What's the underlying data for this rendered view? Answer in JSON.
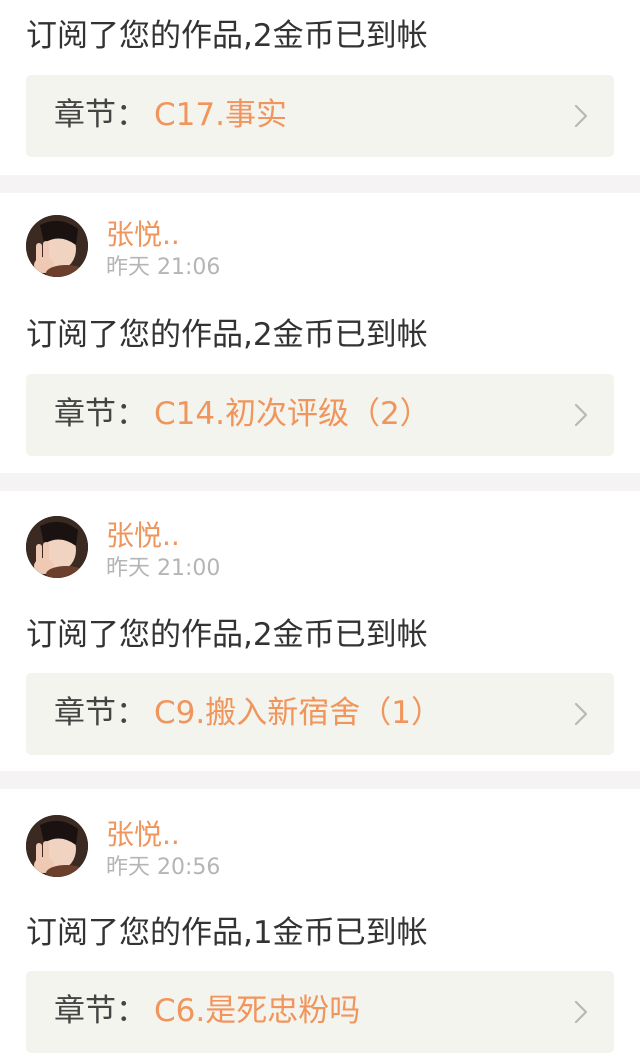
{
  "items": [
    {
      "message": "订阅了您的作品,2金币已到帐",
      "chapter_label": "章节：",
      "chapter_title": "C17.事实"
    },
    {
      "username": "张悦..",
      "time": "昨天 21:06",
      "message": "订阅了您的作品,2金币已到帐",
      "chapter_label": "章节：",
      "chapter_title": "C14.初次评级（2）"
    },
    {
      "username": "张悦..",
      "time": "昨天 21:00",
      "message": "订阅了您的作品,2金币已到帐",
      "chapter_label": "章节：",
      "chapter_title": "C9.搬入新宿舍（1）"
    },
    {
      "username": "张悦..",
      "time": "昨天 20:56",
      "message": "订阅了您的作品,1金币已到帐",
      "chapter_label": "章节：",
      "chapter_title": "C6.是死忠粉吗"
    }
  ],
  "colors": {
    "accent": "#f0955c",
    "separator": "#f5f3f3",
    "chapter_bg": "#f4f4ee",
    "muted": "#b5b5b5"
  },
  "icons": {
    "avatar": "avatar-photo",
    "chevron": "chevron-right-icon"
  }
}
